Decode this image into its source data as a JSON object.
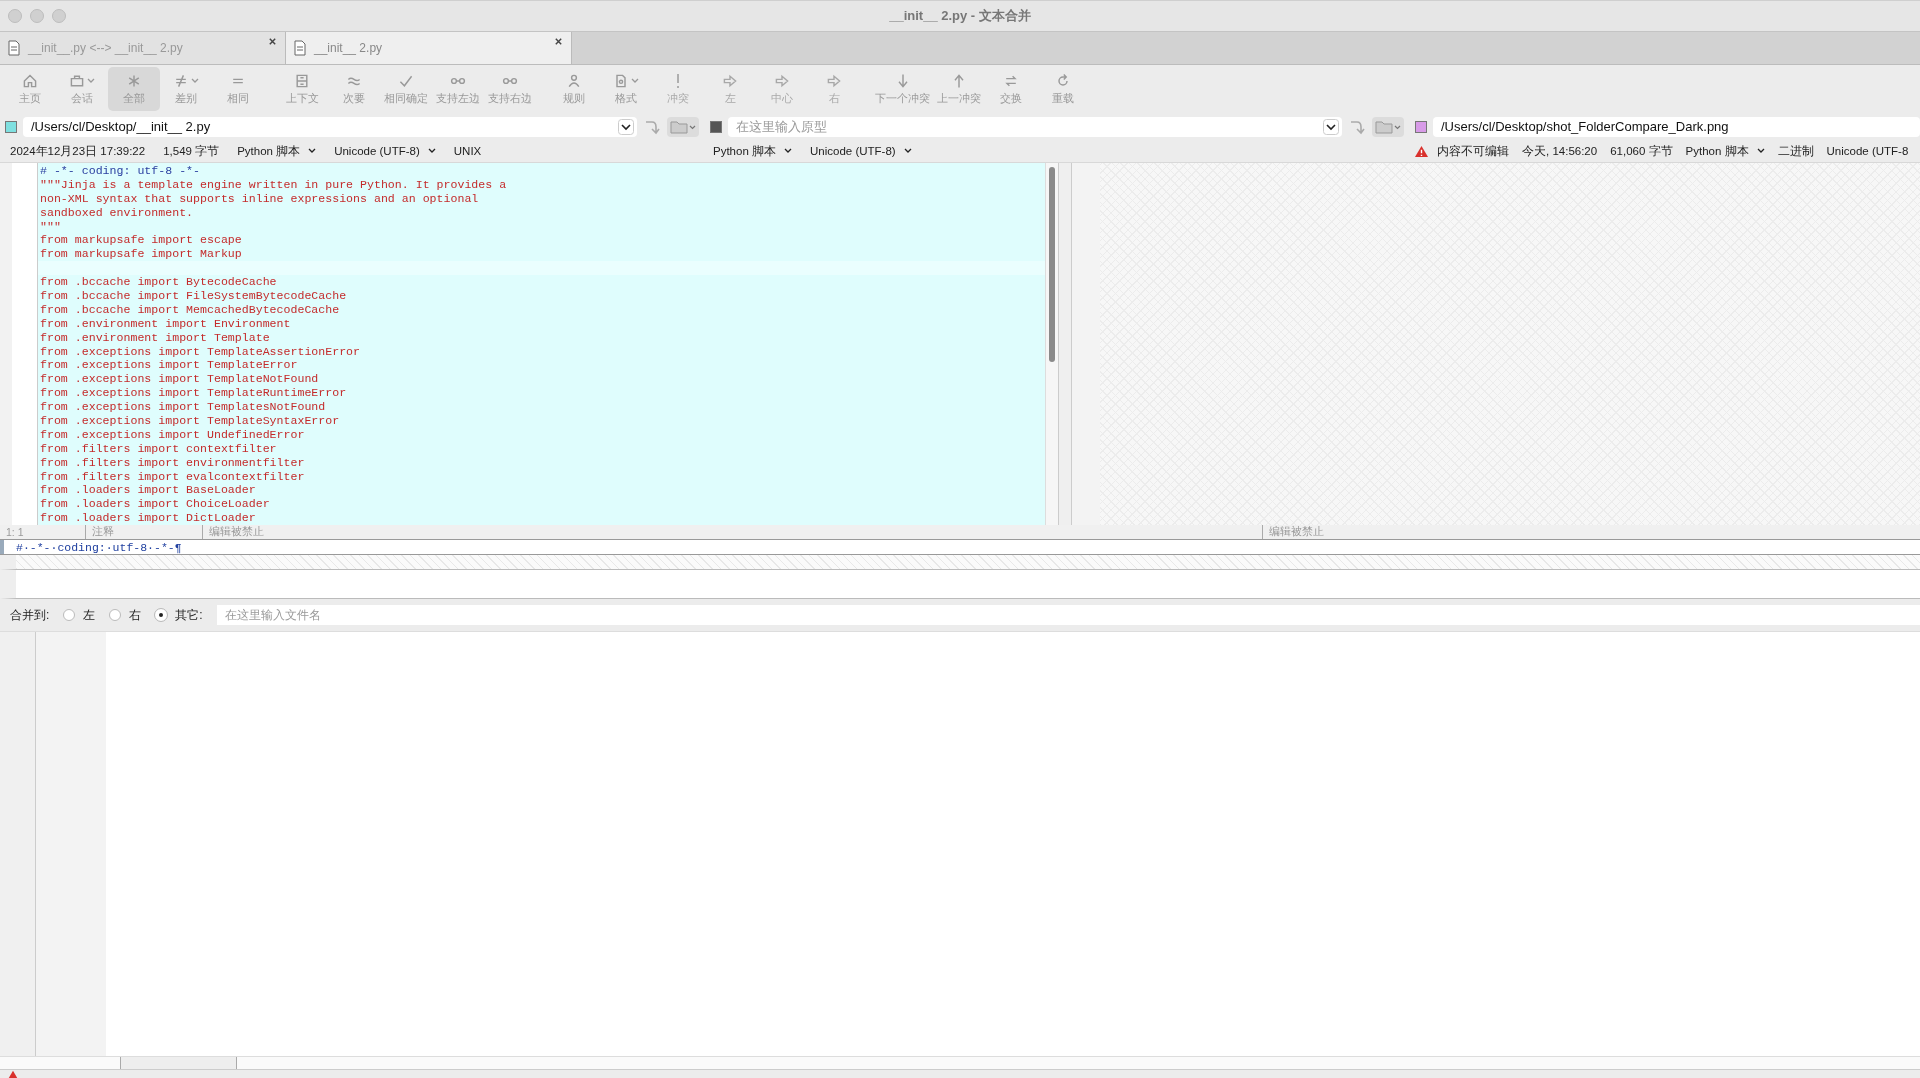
{
  "window": {
    "title": "__init__ 2.py - 文本合并"
  },
  "tabs": [
    {
      "label": "__init__.py <--> __init__ 2.py",
      "selected": false
    },
    {
      "label": "__init__ 2.py",
      "selected": true
    }
  ],
  "toolbar": [
    {
      "label": "主页",
      "selected": false,
      "disabled": false,
      "menu": false
    },
    {
      "label": "会话",
      "selected": false,
      "disabled": false,
      "menu": true
    },
    {
      "label": "全部",
      "selected": true,
      "disabled": false,
      "menu": false
    },
    {
      "label": "差别",
      "selected": false,
      "disabled": false,
      "menu": true
    },
    {
      "label": "相同",
      "selected": false,
      "disabled": false,
      "menu": false
    },
    {
      "label": "上下文",
      "selected": false,
      "disabled": false,
      "menu": false
    },
    {
      "label": "次要",
      "selected": false,
      "disabled": false,
      "menu": false
    },
    {
      "label": "相同确定",
      "selected": false,
      "disabled": false,
      "menu": false
    },
    {
      "label": "支持左边",
      "selected": false,
      "disabled": false,
      "menu": false
    },
    {
      "label": "支持右边",
      "selected": false,
      "disabled": false,
      "menu": false
    },
    {
      "label": "规则",
      "selected": false,
      "disabled": false,
      "menu": false
    },
    {
      "label": "格式",
      "selected": false,
      "disabled": false,
      "menu": true
    },
    {
      "label": "冲突",
      "selected": false,
      "disabled": true,
      "menu": false
    },
    {
      "label": "左",
      "selected": false,
      "disabled": true,
      "menu": false
    },
    {
      "label": "中心",
      "selected": false,
      "disabled": true,
      "menu": false
    },
    {
      "label": "右",
      "selected": false,
      "disabled": true,
      "menu": false
    },
    {
      "label": "下一个冲突",
      "selected": false,
      "disabled": false,
      "menu": false
    },
    {
      "label": "上一冲突",
      "selected": false,
      "disabled": false,
      "menu": false
    },
    {
      "label": "交换",
      "selected": false,
      "disabled": false,
      "menu": false
    },
    {
      "label": "重载",
      "selected": false,
      "disabled": false,
      "menu": false
    }
  ],
  "paths": [
    {
      "color": "#7fe0e0",
      "value": "/Users/cl/Desktop/__init__ 2.py"
    },
    {
      "color": "#555555",
      "placeholder": "在这里输入原型"
    },
    {
      "color": "#d89be8",
      "value": "/Users/cl/Desktop/shot_FolderCompare_Dark.png"
    }
  ],
  "status_left": [
    {
      "text": "2024年12月23日 17:39:22",
      "menu": false
    },
    {
      "text": "1,549 字节",
      "menu": false
    },
    {
      "text": "Python 脚本",
      "menu": true
    },
    {
      "text": "Unicode (UTF-8)",
      "menu": true
    },
    {
      "text": "UNIX",
      "menu": false
    }
  ],
  "status_middle": [
    {
      "text": "Python 脚本",
      "menu": true
    },
    {
      "text": "Unicode (UTF-8)",
      "menu": true
    }
  ],
  "status_right": {
    "warning": "内容不可编辑",
    "items": [
      {
        "text": "今天, 14:56:20",
        "menu": false
      },
      {
        "text": "61,060 字节",
        "menu": false
      },
      {
        "text": "Python 脚本",
        "menu": true
      },
      {
        "text": "二进制",
        "menu": false
      },
      {
        "text": "Unicode (UTF-8",
        "menu": false
      }
    ]
  },
  "left_pane": {
    "lines": [
      {
        "kind": "comment",
        "text": "# -*- coding: utf-8 -*-"
      },
      {
        "kind": "code",
        "text": "\"\"\"Jinja is a template engine written in pure Python. It provides a"
      },
      {
        "kind": "code",
        "text": "non-XML syntax that supports inline expressions and an optional"
      },
      {
        "kind": "code",
        "text": "sandboxed environment."
      },
      {
        "kind": "code",
        "text": "\"\"\""
      },
      {
        "kind": "code",
        "text": "from markupsafe import escape"
      },
      {
        "kind": "code",
        "text": "from markupsafe import Markup"
      },
      {
        "kind": "blank"
      },
      {
        "kind": "code",
        "text": "from .bccache import BytecodeCache"
      },
      {
        "kind": "code",
        "text": "from .bccache import FileSystemBytecodeCache"
      },
      {
        "kind": "code",
        "text": "from .bccache import MemcachedBytecodeCache"
      },
      {
        "kind": "code",
        "text": "from .environment import Environment"
      },
      {
        "kind": "code",
        "text": "from .environment import Template"
      },
      {
        "kind": "code",
        "text": "from .exceptions import TemplateAssertionError"
      },
      {
        "kind": "code",
        "text": "from .exceptions import TemplateError"
      },
      {
        "kind": "code",
        "text": "from .exceptions import TemplateNotFound"
      },
      {
        "kind": "code",
        "text": "from .exceptions import TemplateRuntimeError"
      },
      {
        "kind": "code",
        "text": "from .exceptions import TemplatesNotFound"
      },
      {
        "kind": "code",
        "text": "from .exceptions import TemplateSyntaxError"
      },
      {
        "kind": "code",
        "text": "from .exceptions import UndefinedError"
      },
      {
        "kind": "code",
        "text": "from .filters import contextfilter"
      },
      {
        "kind": "code",
        "text": "from .filters import environmentfilter"
      },
      {
        "kind": "code",
        "text": "from .filters import evalcontextfilter"
      },
      {
        "kind": "code",
        "text": "from .loaders import BaseLoader"
      },
      {
        "kind": "code",
        "text": "from .loaders import ChoiceLoader"
      },
      {
        "kind": "code",
        "text": "from .loaders import DictLoader"
      }
    ],
    "status": [
      "1: 1",
      "注释",
      "编辑被禁止"
    ]
  },
  "right_pane": {
    "status": [
      "编辑被禁止"
    ]
  },
  "diff_line": "#·-*-·coding:·utf-8·-*-¶",
  "merge": {
    "label": "合并到:",
    "options": [
      {
        "label": "左",
        "selected": false
      },
      {
        "label": "右",
        "selected": false
      },
      {
        "label": "其它:",
        "selected": true
      }
    ],
    "placeholder": "在这里输入文件名"
  }
}
